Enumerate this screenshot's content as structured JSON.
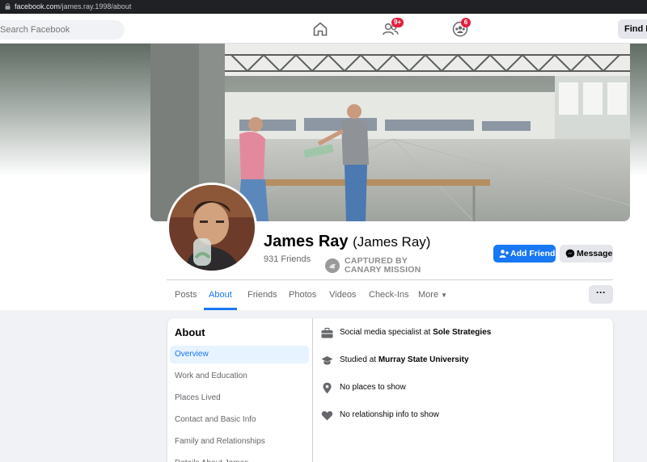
{
  "browser": {
    "url_host": "facebook.com",
    "url_path": "/james.ray.1998/about"
  },
  "topnav": {
    "search_placeholder": "Search Facebook",
    "friends_badge": "9+",
    "groups_badge": "6",
    "find_friends": "Find Friends"
  },
  "profile": {
    "name": "James Ray",
    "alt_name": "(James Ray)",
    "friends_count": "931 Friends",
    "stamp_line1": "CAPTURED BY",
    "stamp_line2": "CANARY MISSION",
    "add_friend_label": "Add Friend",
    "message_label": "Message",
    "more_button": "···"
  },
  "tabs": [
    {
      "label": "Posts"
    },
    {
      "label": "About"
    },
    {
      "label": "Friends"
    },
    {
      "label": "Photos"
    },
    {
      "label": "Videos"
    },
    {
      "label": "Check-Ins"
    },
    {
      "label": "More"
    }
  ],
  "active_tab": "About",
  "about": {
    "title": "About",
    "nav": [
      {
        "label": "Overview"
      },
      {
        "label": "Work and Education"
      },
      {
        "label": "Places Lived"
      },
      {
        "label": "Contact and Basic Info"
      },
      {
        "label": "Family and Relationships"
      },
      {
        "label": "Details About James"
      }
    ],
    "overview": {
      "work_prefix": "Social media specialist at ",
      "work_org": "Sole Strategies",
      "edu_prefix": "Studied at ",
      "edu_org": "Murray State University",
      "places": "No places to show",
      "relationship": "No relationship info to show"
    }
  },
  "colors": {
    "brand_blue": "#1877f2",
    "badge_red": "#e41e3f",
    "stamp_gray": "#8d8d8d"
  },
  "icons": [
    "lock-icon",
    "home-icon",
    "friends-icon",
    "groups-icon",
    "add-friend-icon",
    "messenger-icon",
    "briefcase-icon",
    "graduation-cap-icon",
    "location-pin-icon",
    "heart-icon"
  ]
}
